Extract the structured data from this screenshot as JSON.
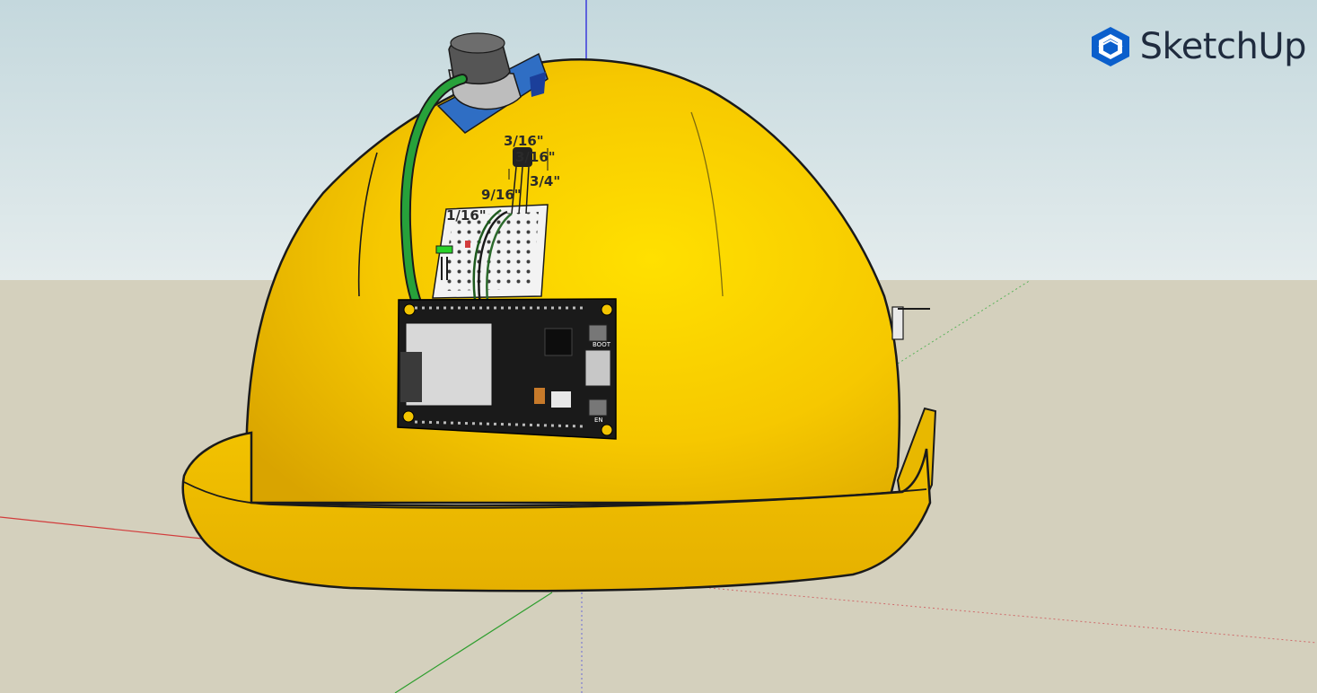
{
  "app": {
    "brand_name": "SketchUp",
    "brand_icon": "sketchup-logo-icon"
  },
  "model": {
    "object": "hard-hat",
    "dimensions": {
      "d1": "3/16\"",
      "d2": "3/16\"",
      "d3": "3/4\"",
      "d4": "9/16\"",
      "d5": "1/16\""
    },
    "board_labels": {
      "boot": "BOOT",
      "en": "EN"
    }
  },
  "colors": {
    "sky": "#c9dbe0",
    "ground": "#d4d0bd",
    "helmet": "#f2c400",
    "axis_red": "#d23c3c",
    "axis_green": "#2e9e2e",
    "axis_blue": "#3a3adb",
    "board": "#1a1a1a",
    "wire_green": "#27a13a"
  }
}
